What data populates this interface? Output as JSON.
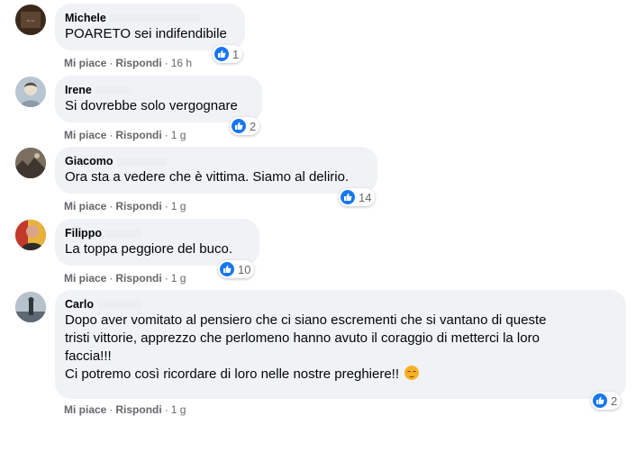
{
  "comments": [
    {
      "author": "Michele",
      "text": "POARETO sei indifendibile",
      "like_label": "Mi piace",
      "reply_label": "Rispondi",
      "time": "16 h",
      "reactions": "1",
      "avatar_color": "#3b2a1a"
    },
    {
      "author": "Irene",
      "text": "Si dovrebbe solo vergognare",
      "like_label": "Mi piace",
      "reply_label": "Rispondi",
      "time": "1 g",
      "reactions": "2",
      "avatar_color": "#a9b8c4"
    },
    {
      "author": "Giacomo",
      "text": "Ora sta a vedere che è vittima. Siamo al delirio.",
      "like_label": "Mi piace",
      "reply_label": "Rispondi",
      "time": "1 g",
      "reactions": "14",
      "avatar_color": "#4a4238"
    },
    {
      "author": "Filippo",
      "text": "La toppa peggiore del buco.",
      "like_label": "Mi piace",
      "reply_label": "Rispondi",
      "time": "1 g",
      "reactions": "10",
      "avatar_color": "#c0392b"
    },
    {
      "author": "Carlo",
      "text": "Dopo aver vomitato al pensiero che ci siano escrementi che si vantano di queste\ntristi vittorie, apprezzo che perlomeno hanno avuto il coraggio di metterci la loro\nfaccia!!!\nCi potremo così ricordare di loro nelle nostre preghiere!! ",
      "like_label": "Mi piace",
      "reply_label": "Rispondi",
      "time": "1 g",
      "reactions": "2",
      "avatar_color": "#6b7785"
    }
  ],
  "colors": {
    "bubble": "#f0f2f5",
    "like_blue": "#1877f2",
    "meta_gray": "#65676b"
  },
  "icons": {
    "reaction": "like-thumb-icon",
    "emoji": "pensive-face-emoji-icon"
  }
}
